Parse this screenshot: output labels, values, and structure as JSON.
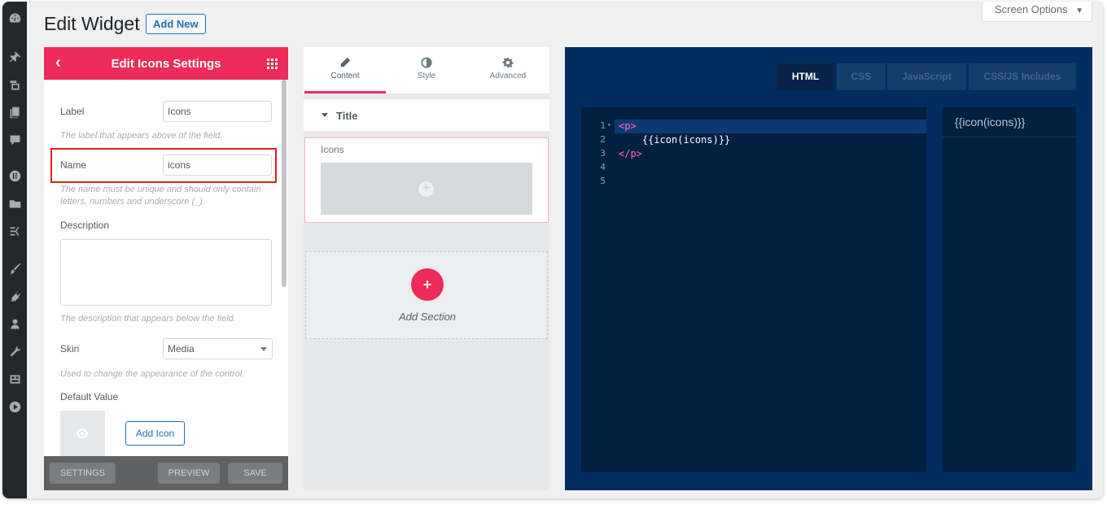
{
  "header": {
    "page_title": "Edit Widget",
    "add_new_label": "Add New",
    "screen_options_label": "Screen Options"
  },
  "admin_menu": {
    "icons": [
      "dashboard-icon",
      "pin-icon",
      "media-icon",
      "pages-icon",
      "comments-icon",
      "elementor-icon",
      "folder-icon",
      "elementskit-icon",
      "brush-icon",
      "plugins-icon",
      "users-icon",
      "tools-icon",
      "settings-icon",
      "play-icon"
    ]
  },
  "settings_panel": {
    "title": "Edit Icons Settings",
    "label_field": {
      "label": "Label",
      "value": "Icons",
      "help": "The label that appears above of the field."
    },
    "name_field": {
      "label": "Name",
      "value": "icons",
      "help": "The name must be unique and should only contain letters, numbers and underscore (_)."
    },
    "description_field": {
      "label": "Description",
      "help": "The description that appears below the field."
    },
    "skin_field": {
      "label": "Skin",
      "value": "Media",
      "help": "Used to change the appearance of the control."
    },
    "default_value": {
      "label": "Default Value",
      "button_label": "Add Icon"
    },
    "footer": {
      "settings_label": "SETTINGS",
      "preview_label": "PREVIEW",
      "save_label": "SAVE"
    }
  },
  "editor_panel": {
    "tabs": [
      {
        "label": "Content",
        "icon": "pencil-icon"
      },
      {
        "label": "Style",
        "icon": "contrast-icon"
      },
      {
        "label": "Advanced",
        "icon": "gear-icon"
      }
    ],
    "section_title": "Title",
    "icons_control_label": "Icons",
    "add_section_label": "Add Section"
  },
  "code_panel": {
    "tabs": [
      "HTML",
      "CSS",
      "JavaScript",
      "CSS/JS Includes"
    ],
    "active_tab": "HTML",
    "line_numbers": [
      "1",
      "2",
      "3",
      "4",
      "5"
    ],
    "code_lines": [
      {
        "tag": "<p>",
        "text": ""
      },
      {
        "tag": "",
        "text": "    {{icon(icons)}}"
      },
      {
        "tag": "</p>",
        "text": ""
      },
      {
        "tag": "",
        "text": ""
      },
      {
        "tag": "",
        "text": ""
      }
    ],
    "preview_text": "{{icon(icons)}}"
  },
  "colors": {
    "accent": "#ed2c5b",
    "code_bg": "#002d5e",
    "admin_bar": "#23282d"
  }
}
